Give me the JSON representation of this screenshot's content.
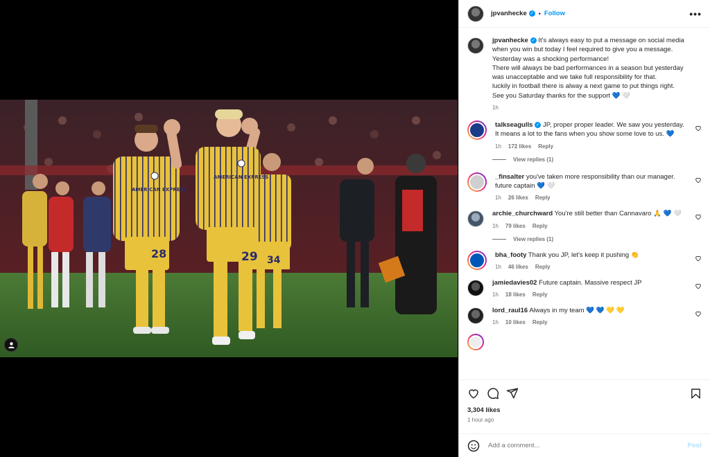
{
  "post": {
    "author": "jpvanhecke",
    "follow_label": "Follow",
    "dot": "•",
    "more_label": "•••",
    "caption_lines": [
      "It's always easy to put a message on social media",
      "when you win but today I feel required to give you a message.",
      "Yesterday was a shocking performance!",
      "There will always be bad performances in a season but yesterday",
      "was unacceptable and we take full responsibility for that.",
      "luckily in football there is alway a next game to put things right.",
      "See you Saturday thanks for the support 💙 🤍"
    ],
    "caption_time": "1h",
    "likes": "3,304 likes",
    "time_ago": "1 hour ago",
    "comment_placeholder": "Add a comment...",
    "post_label": "Post",
    "shirt_numbers": [
      "28",
      "29",
      "34"
    ],
    "sponsor": "AMERICAN EXPRESS"
  },
  "comments": [
    {
      "user": "talkseagulls",
      "verified": true,
      "text_lines": [
        "JP, proper proper leader. We saw you yesterday.",
        "It means a lot to the fans when you show some love to us. 💙"
      ],
      "time": "1h",
      "likes": "172 likes",
      "reply": "Reply",
      "view_replies": "View replies (1)"
    },
    {
      "user": "_finsalter",
      "verified": false,
      "text_lines": [
        "you've taken more responsibility than our manager.",
        "future captain 💙 🤍"
      ],
      "time": "1h",
      "likes": "26 likes",
      "reply": "Reply"
    },
    {
      "user": "archie_churchward",
      "verified": false,
      "text_lines": [
        "You're still better than Cannavaro 🙏 💙 🤍"
      ],
      "time": "1h",
      "likes": "79 likes",
      "reply": "Reply",
      "view_replies": "View replies (1)"
    },
    {
      "user": "bha_footy",
      "verified": false,
      "text_lines": [
        "Thank you JP, let's keep it pushing 👏"
      ],
      "time": "1h",
      "likes": "46 likes",
      "reply": "Reply"
    },
    {
      "user": "jamiedavies02",
      "verified": false,
      "text_lines": [
        "Future captain. Massive respect JP"
      ],
      "time": "1h",
      "likes": "18 likes",
      "reply": "Reply"
    },
    {
      "user": "lord_raul16",
      "verified": false,
      "text_lines": [
        "Always in my team 💙 💙 💛 💛"
      ],
      "time": "1h",
      "likes": "10 likes",
      "reply": "Reply"
    }
  ],
  "icons": {
    "tag": "user-tag-icon",
    "like": "heart-icon",
    "comment": "comment-icon",
    "share": "paper-plane-icon",
    "save": "bookmark-icon",
    "emoji": "smiley-icon"
  },
  "colors": {
    "accent": "#0095f6",
    "kit_yellow": "#e8c23a",
    "kit_stripe": "#2b2a6b",
    "pitch": "#3e6b2e",
    "opponent_red": "#c42a2a"
  }
}
